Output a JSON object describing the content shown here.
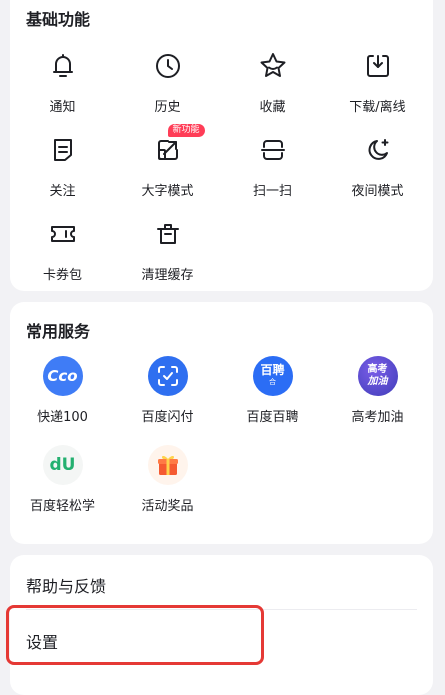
{
  "basic": {
    "title": "基础功能",
    "items": [
      {
        "label": "通知",
        "icon": "bell-icon"
      },
      {
        "label": "历史",
        "icon": "clock-icon"
      },
      {
        "label": "收藏",
        "icon": "star-icon"
      },
      {
        "label": "下载/离线",
        "icon": "download-icon"
      },
      {
        "label": "关注",
        "icon": "follow-icon"
      },
      {
        "label": "大字模式",
        "icon": "large-text-icon",
        "badge": "新功能"
      },
      {
        "label": "扫一扫",
        "icon": "scan-icon"
      },
      {
        "label": "夜间模式",
        "icon": "moon-icon"
      },
      {
        "label": "卡券包",
        "icon": "ticket-icon"
      },
      {
        "label": "清理缓存",
        "icon": "trash-icon"
      }
    ]
  },
  "services": {
    "title": "常用服务",
    "items": [
      {
        "label": "快递100",
        "icon": "express-icon",
        "icon_text": "Cco"
      },
      {
        "label": "百度闪付",
        "icon": "pay-scan-icon"
      },
      {
        "label": "百度百聘",
        "icon": "recruit-icon",
        "icon_text": "百聘",
        "icon_subtext": "合"
      },
      {
        "label": "高考加油",
        "icon": "gaokao-icon",
        "icon_text": "高考",
        "icon_subtext": "加油"
      },
      {
        "label": "百度轻松学",
        "icon": "learning-icon",
        "icon_text": "dU"
      },
      {
        "label": "活动奖品",
        "icon": "gift-icon"
      }
    ]
  },
  "misc": {
    "help_label": "帮助与反馈",
    "settings_label": "设置"
  },
  "colors": {
    "badge": "#ff3d57",
    "highlight": "#e53935",
    "express_bg": "#3f7cf6",
    "pay_bg": "#2f6ff0",
    "recruit_bg": "#2b6df5",
    "gaokao_bg": "#3f3db8",
    "learning_green": "#24b070",
    "gift_orange": "#f55a31"
  }
}
